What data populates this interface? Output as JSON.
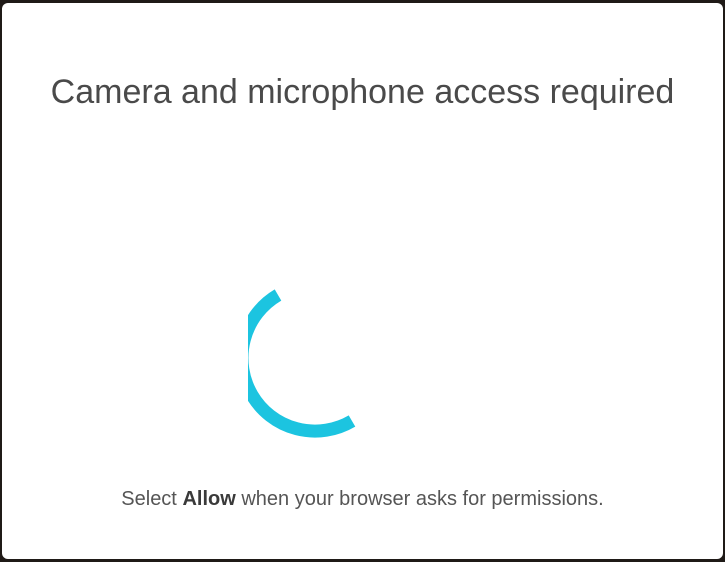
{
  "dialog": {
    "title": "Camera and microphone access required",
    "instruction_prefix": "Select ",
    "instruction_bold": "Allow",
    "instruction_suffix": " when your browser asks for permissions."
  },
  "spinner": {
    "icon": "loading-spinner-icon",
    "color": "#1cc4e0"
  }
}
